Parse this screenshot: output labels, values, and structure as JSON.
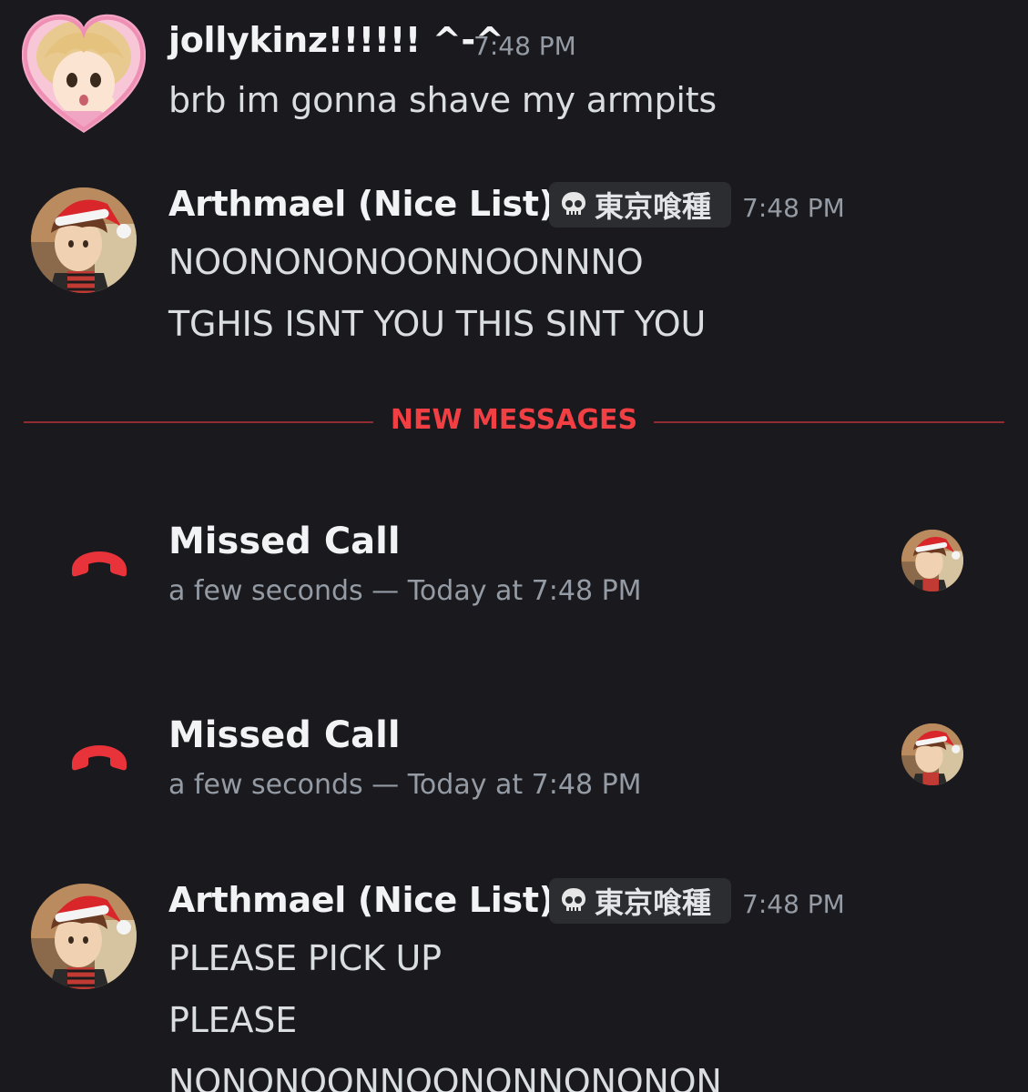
{
  "messages": [
    {
      "username": "jollykinz!!!!!! ^-^",
      "timestamp": "7:48 PM",
      "lines": [
        "brb im gonna shave my armpits"
      ]
    },
    {
      "username": "Arthmael (Nice List)",
      "tag": {
        "icon": "skull-icon",
        "text": "東京喰種"
      },
      "timestamp": "7:48 PM",
      "lines": [
        "NOONONONOONNOONNNO",
        "TGHIS ISNT YOU THIS SINT YOU"
      ]
    },
    {
      "username": "Arthmael (Nice List)",
      "tag": {
        "icon": "skull-icon",
        "text": "東京喰種"
      },
      "timestamp": "7:48 PM",
      "lines": [
        "PLEASE PICK UP",
        "PLEASE",
        "NONONOONNOONONNONONON"
      ]
    }
  ],
  "divider": {
    "label": "NEW MESSAGES"
  },
  "calls": [
    {
      "title": "Missed Call",
      "subtitle": "a few seconds — Today at 7:48 PM"
    },
    {
      "title": "Missed Call",
      "subtitle": "a few seconds — Today at 7:48 PM"
    }
  ],
  "colors": {
    "background": "#1a1a1e",
    "new_messages": "#f23f43",
    "missed_call_icon": "#e8333a",
    "username": "#f2f3f5",
    "muted": "#949ba4"
  }
}
